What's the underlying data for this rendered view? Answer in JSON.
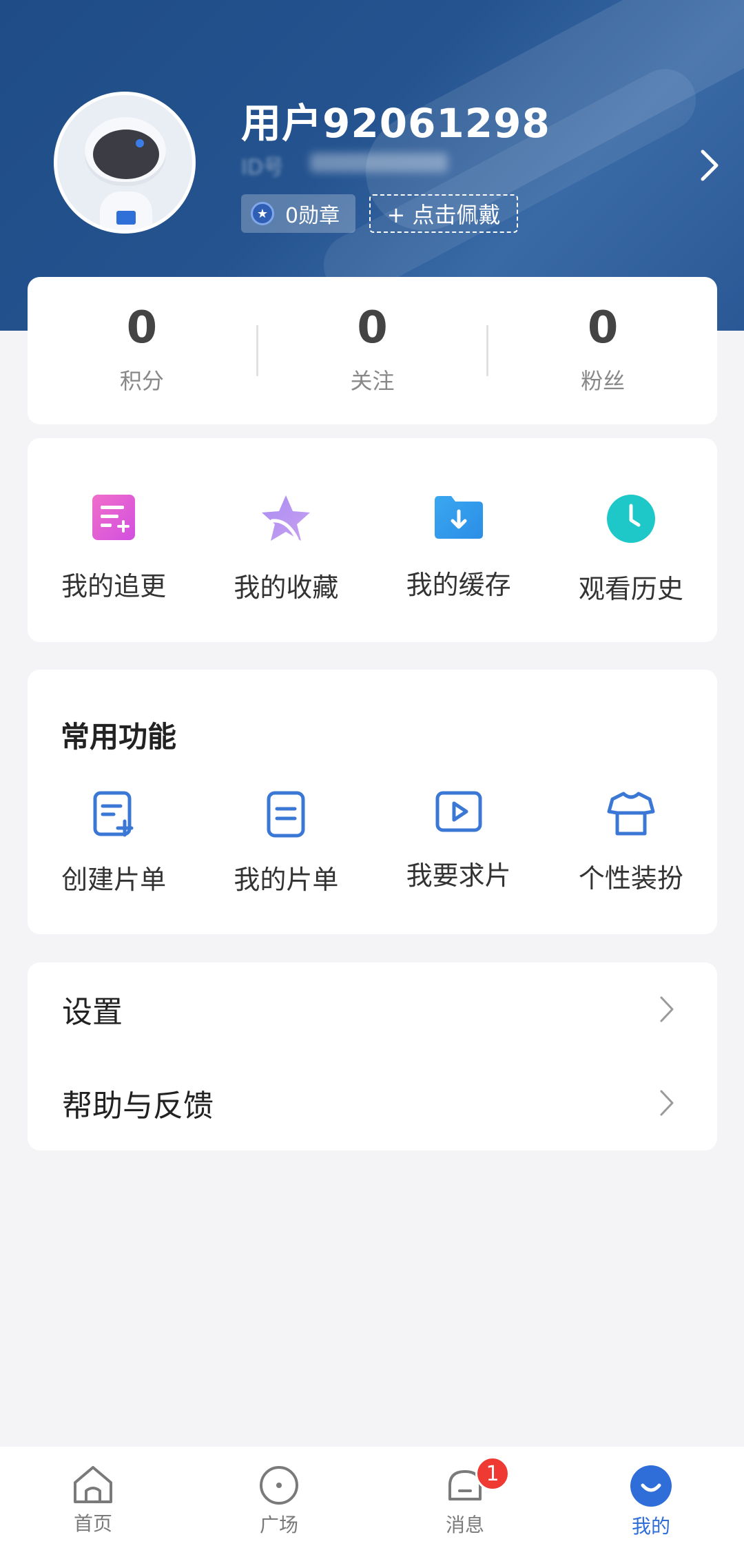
{
  "profile": {
    "username": "用户92061298",
    "id_label": "ID号",
    "medal_text": "0勋章",
    "wear_button": "+ 点击佩戴"
  },
  "stats": [
    {
      "value": "0",
      "label": "积分"
    },
    {
      "value": "0",
      "label": "关注"
    },
    {
      "value": "0",
      "label": "粉丝"
    }
  ],
  "quick_actions": [
    {
      "label": "我的追更",
      "icon": "updates-icon"
    },
    {
      "label": "我的收藏",
      "icon": "star-icon"
    },
    {
      "label": "我的缓存",
      "icon": "download-folder-icon"
    },
    {
      "label": "观看历史",
      "icon": "clock-icon"
    }
  ],
  "common": {
    "title": "常用功能",
    "items": [
      {
        "label": "创建片单",
        "icon": "create-list-icon"
      },
      {
        "label": "我的片单",
        "icon": "list-icon"
      },
      {
        "label": "我要求片",
        "icon": "play-request-icon"
      },
      {
        "label": "个性装扮",
        "icon": "shirt-icon"
      }
    ]
  },
  "menu": [
    {
      "label": "设置"
    },
    {
      "label": "帮助与反馈"
    }
  ],
  "tabbar": {
    "tabs": [
      {
        "label": "首页",
        "icon": "home-icon"
      },
      {
        "label": "广场",
        "icon": "plaza-icon"
      },
      {
        "label": "消息",
        "icon": "bell-icon",
        "badge": "1"
      },
      {
        "label": "我的",
        "icon": "profile-icon",
        "active": true
      }
    ]
  },
  "colors": {
    "header_blue": "#24538f",
    "accent_blue": "#2f6ed9",
    "badge_red": "#ee3a32"
  }
}
